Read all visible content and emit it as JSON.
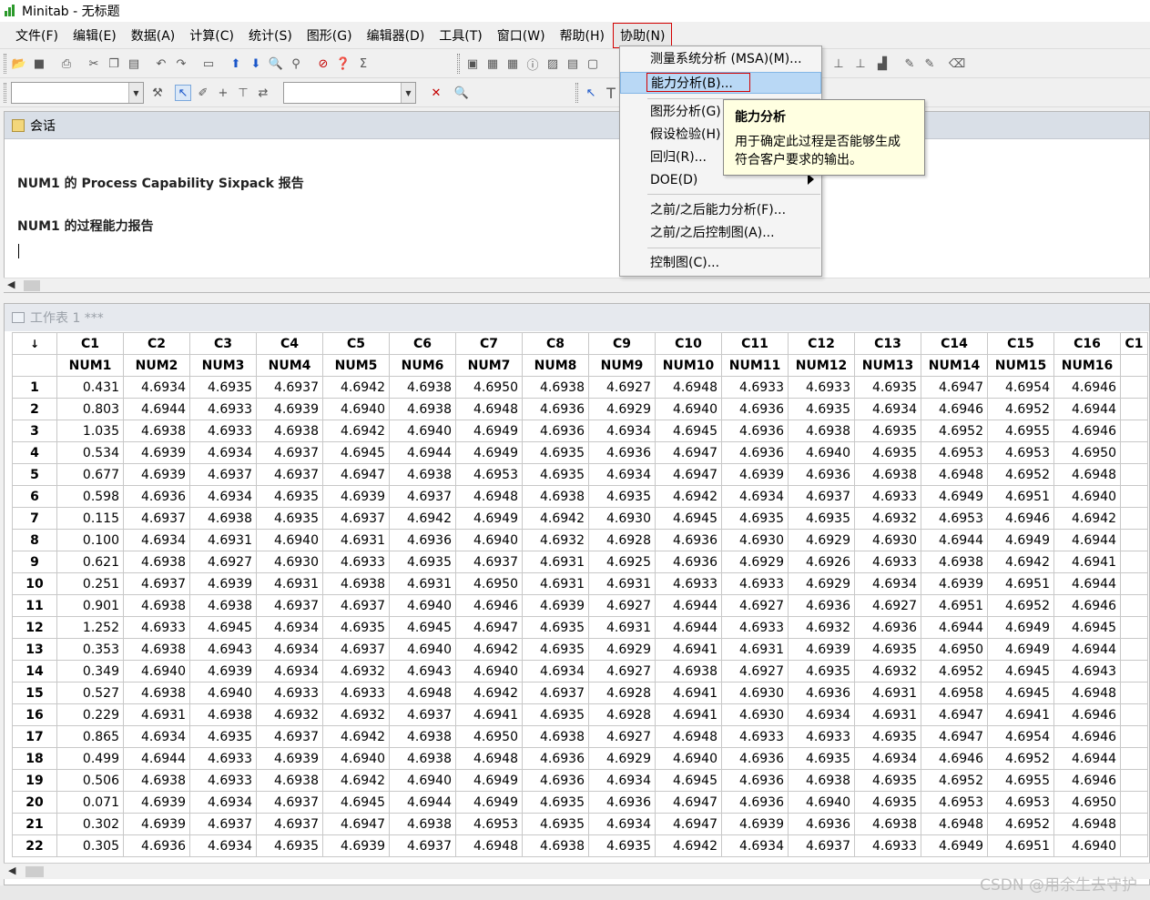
{
  "window": {
    "title": "Minitab - 无标题"
  },
  "menubar": {
    "items": [
      "文件(F)",
      "编辑(E)",
      "数据(A)",
      "计算(C)",
      "统计(S)",
      "图形(G)",
      "编辑器(D)",
      "工具(T)",
      "窗口(W)",
      "帮助(H)",
      "协助(N)"
    ],
    "active_index": 10
  },
  "assist_menu": {
    "items": [
      {
        "label": "测量系统分析 (MSA)(M)..."
      },
      {
        "label": "能力分析(B)...",
        "highlighted": true
      },
      {
        "label": "图形分析(G)"
      },
      {
        "label": "假设检验(H)"
      },
      {
        "label": "回归(R)..."
      },
      {
        "label": "DOE(D)",
        "submenu": true
      },
      {
        "label": "之前/之后能力分析(F)..."
      },
      {
        "label": "之前/之后控制图(A)..."
      },
      {
        "label": "控制图(C)..."
      }
    ]
  },
  "tooltip": {
    "title": "能力分析",
    "line1": "用于确定此过程是否能够生成",
    "line2": "符合客户要求的输出。"
  },
  "session": {
    "title": "会话",
    "line1": "NUM1 的 Process Capability Sixpack 报告",
    "line2": "NUM1 的过程能力报告"
  },
  "worksheet": {
    "title": "工作表 1 ***",
    "corner": "↓",
    "col_ids": [
      "C1",
      "C2",
      "C3",
      "C4",
      "C5",
      "C6",
      "C7",
      "C8",
      "C9",
      "C10",
      "C11",
      "C12",
      "C13",
      "C14",
      "C15",
      "C16",
      "C1"
    ],
    "col_names": [
      "NUM1",
      "NUM2",
      "NUM3",
      "NUM4",
      "NUM5",
      "NUM6",
      "NUM7",
      "NUM8",
      "NUM9",
      "NUM10",
      "NUM11",
      "NUM12",
      "NUM13",
      "NUM14",
      "NUM15",
      "NUM16",
      ""
    ],
    "rows": [
      [
        "1",
        "0.431",
        "4.6934",
        "4.6935",
        "4.6937",
        "4.6942",
        "4.6938",
        "4.6950",
        "4.6938",
        "4.6927",
        "4.6948",
        "4.6933",
        "4.6933",
        "4.6935",
        "4.6947",
        "4.6954",
        "4.6946"
      ],
      [
        "2",
        "0.803",
        "4.6944",
        "4.6933",
        "4.6939",
        "4.6940",
        "4.6938",
        "4.6948",
        "4.6936",
        "4.6929",
        "4.6940",
        "4.6936",
        "4.6935",
        "4.6934",
        "4.6946",
        "4.6952",
        "4.6944"
      ],
      [
        "3",
        "1.035",
        "4.6938",
        "4.6933",
        "4.6938",
        "4.6942",
        "4.6940",
        "4.6949",
        "4.6936",
        "4.6934",
        "4.6945",
        "4.6936",
        "4.6938",
        "4.6935",
        "4.6952",
        "4.6955",
        "4.6946"
      ],
      [
        "4",
        "0.534",
        "4.6939",
        "4.6934",
        "4.6937",
        "4.6945",
        "4.6944",
        "4.6949",
        "4.6935",
        "4.6936",
        "4.6947",
        "4.6936",
        "4.6940",
        "4.6935",
        "4.6953",
        "4.6953",
        "4.6950"
      ],
      [
        "5",
        "0.677",
        "4.6939",
        "4.6937",
        "4.6937",
        "4.6947",
        "4.6938",
        "4.6953",
        "4.6935",
        "4.6934",
        "4.6947",
        "4.6939",
        "4.6936",
        "4.6938",
        "4.6948",
        "4.6952",
        "4.6948"
      ],
      [
        "6",
        "0.598",
        "4.6936",
        "4.6934",
        "4.6935",
        "4.6939",
        "4.6937",
        "4.6948",
        "4.6938",
        "4.6935",
        "4.6942",
        "4.6934",
        "4.6937",
        "4.6933",
        "4.6949",
        "4.6951",
        "4.6940"
      ],
      [
        "7",
        "0.115",
        "4.6937",
        "4.6938",
        "4.6935",
        "4.6937",
        "4.6942",
        "4.6949",
        "4.6942",
        "4.6930",
        "4.6945",
        "4.6935",
        "4.6935",
        "4.6932",
        "4.6953",
        "4.6946",
        "4.6942"
      ],
      [
        "8",
        "0.100",
        "4.6934",
        "4.6931",
        "4.6940",
        "4.6931",
        "4.6936",
        "4.6940",
        "4.6932",
        "4.6928",
        "4.6936",
        "4.6930",
        "4.6929",
        "4.6930",
        "4.6944",
        "4.6949",
        "4.6944"
      ],
      [
        "9",
        "0.621",
        "4.6938",
        "4.6927",
        "4.6930",
        "4.6933",
        "4.6935",
        "4.6937",
        "4.6931",
        "4.6925",
        "4.6936",
        "4.6929",
        "4.6926",
        "4.6933",
        "4.6938",
        "4.6942",
        "4.6941"
      ],
      [
        "10",
        "0.251",
        "4.6937",
        "4.6939",
        "4.6931",
        "4.6938",
        "4.6931",
        "4.6950",
        "4.6931",
        "4.6931",
        "4.6933",
        "4.6933",
        "4.6929",
        "4.6934",
        "4.6939",
        "4.6951",
        "4.6944"
      ],
      [
        "11",
        "0.901",
        "4.6938",
        "4.6938",
        "4.6937",
        "4.6937",
        "4.6940",
        "4.6946",
        "4.6939",
        "4.6927",
        "4.6944",
        "4.6927",
        "4.6936",
        "4.6927",
        "4.6951",
        "4.6952",
        "4.6946"
      ],
      [
        "12",
        "1.252",
        "4.6933",
        "4.6945",
        "4.6934",
        "4.6935",
        "4.6945",
        "4.6947",
        "4.6935",
        "4.6931",
        "4.6944",
        "4.6933",
        "4.6932",
        "4.6936",
        "4.6944",
        "4.6949",
        "4.6945"
      ],
      [
        "13",
        "0.353",
        "4.6938",
        "4.6943",
        "4.6934",
        "4.6937",
        "4.6940",
        "4.6942",
        "4.6935",
        "4.6929",
        "4.6941",
        "4.6931",
        "4.6939",
        "4.6935",
        "4.6950",
        "4.6949",
        "4.6944"
      ],
      [
        "14",
        "0.349",
        "4.6940",
        "4.6939",
        "4.6934",
        "4.6932",
        "4.6943",
        "4.6940",
        "4.6934",
        "4.6927",
        "4.6938",
        "4.6927",
        "4.6935",
        "4.6932",
        "4.6952",
        "4.6945",
        "4.6943"
      ],
      [
        "15",
        "0.527",
        "4.6938",
        "4.6940",
        "4.6933",
        "4.6933",
        "4.6948",
        "4.6942",
        "4.6937",
        "4.6928",
        "4.6941",
        "4.6930",
        "4.6936",
        "4.6931",
        "4.6958",
        "4.6945",
        "4.6948"
      ],
      [
        "16",
        "0.229",
        "4.6931",
        "4.6938",
        "4.6932",
        "4.6932",
        "4.6937",
        "4.6941",
        "4.6935",
        "4.6928",
        "4.6941",
        "4.6930",
        "4.6934",
        "4.6931",
        "4.6947",
        "4.6941",
        "4.6946"
      ],
      [
        "17",
        "0.865",
        "4.6934",
        "4.6935",
        "4.6937",
        "4.6942",
        "4.6938",
        "4.6950",
        "4.6938",
        "4.6927",
        "4.6948",
        "4.6933",
        "4.6933",
        "4.6935",
        "4.6947",
        "4.6954",
        "4.6946"
      ],
      [
        "18",
        "0.499",
        "4.6944",
        "4.6933",
        "4.6939",
        "4.6940",
        "4.6938",
        "4.6948",
        "4.6936",
        "4.6929",
        "4.6940",
        "4.6936",
        "4.6935",
        "4.6934",
        "4.6946",
        "4.6952",
        "4.6944"
      ],
      [
        "19",
        "0.506",
        "4.6938",
        "4.6933",
        "4.6938",
        "4.6942",
        "4.6940",
        "4.6949",
        "4.6936",
        "4.6934",
        "4.6945",
        "4.6936",
        "4.6938",
        "4.6935",
        "4.6952",
        "4.6955",
        "4.6946"
      ],
      [
        "20",
        "0.071",
        "4.6939",
        "4.6934",
        "4.6937",
        "4.6945",
        "4.6944",
        "4.6949",
        "4.6935",
        "4.6936",
        "4.6947",
        "4.6936",
        "4.6940",
        "4.6935",
        "4.6953",
        "4.6953",
        "4.6950"
      ],
      [
        "21",
        "0.302",
        "4.6939",
        "4.6937",
        "4.6937",
        "4.6947",
        "4.6938",
        "4.6953",
        "4.6935",
        "4.6934",
        "4.6947",
        "4.6939",
        "4.6936",
        "4.6938",
        "4.6948",
        "4.6952",
        "4.6948"
      ],
      [
        "22",
        "0.305",
        "4.6936",
        "4.6934",
        "4.6935",
        "4.6939",
        "4.6937",
        "4.6948",
        "4.6938",
        "4.6935",
        "4.6942",
        "4.6934",
        "4.6937",
        "4.6933",
        "4.6949",
        "4.6951",
        "4.6940"
      ]
    ]
  },
  "watermark": "CSDN @用余生去守护",
  "colors": {
    "highlight": "#b9d8f5",
    "tooltip_bg": "#ffffe1",
    "annotation_red": "#d40000"
  }
}
